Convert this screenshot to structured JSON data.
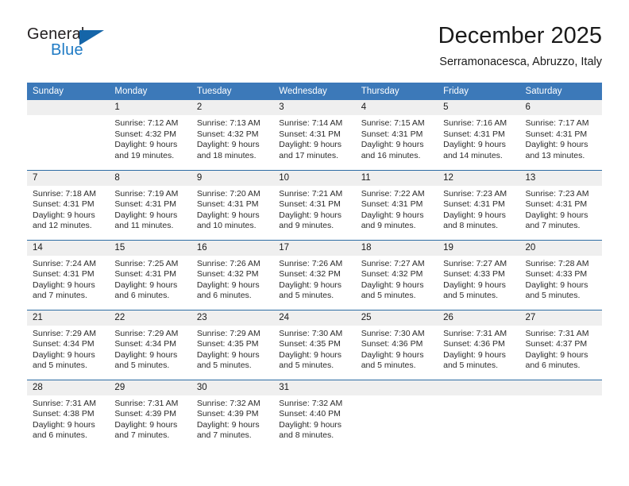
{
  "brand": {
    "name_top": "General",
    "name_bottom": "Blue",
    "triangle_icon": "blue-triangle-logo-mark",
    "color_top": "#231f20",
    "color_bottom": "#1e7ac4"
  },
  "header": {
    "title": "December 2025",
    "subtitle": "Serramonacesca, Abruzzo, Italy"
  },
  "theme": {
    "header_blue": "#3c79b9",
    "rule_blue": "#2e6da4",
    "daynum_gray": "#efefef"
  },
  "calendar": {
    "weekday_headers": [
      "Sunday",
      "Monday",
      "Tuesday",
      "Wednesday",
      "Thursday",
      "Friday",
      "Saturday"
    ],
    "weeks": [
      [
        {
          "day": "",
          "lines": []
        },
        {
          "day": "1",
          "lines": [
            "Sunrise: 7:12 AM",
            "Sunset: 4:32 PM",
            "Daylight: 9 hours",
            "and 19 minutes."
          ]
        },
        {
          "day": "2",
          "lines": [
            "Sunrise: 7:13 AM",
            "Sunset: 4:32 PM",
            "Daylight: 9 hours",
            "and 18 minutes."
          ]
        },
        {
          "day": "3",
          "lines": [
            "Sunrise: 7:14 AM",
            "Sunset: 4:31 PM",
            "Daylight: 9 hours",
            "and 17 minutes."
          ]
        },
        {
          "day": "4",
          "lines": [
            "Sunrise: 7:15 AM",
            "Sunset: 4:31 PM",
            "Daylight: 9 hours",
            "and 16 minutes."
          ]
        },
        {
          "day": "5",
          "lines": [
            "Sunrise: 7:16 AM",
            "Sunset: 4:31 PM",
            "Daylight: 9 hours",
            "and 14 minutes."
          ]
        },
        {
          "day": "6",
          "lines": [
            "Sunrise: 7:17 AM",
            "Sunset: 4:31 PM",
            "Daylight: 9 hours",
            "and 13 minutes."
          ]
        }
      ],
      [
        {
          "day": "7",
          "lines": [
            "Sunrise: 7:18 AM",
            "Sunset: 4:31 PM",
            "Daylight: 9 hours",
            "and 12 minutes."
          ]
        },
        {
          "day": "8",
          "lines": [
            "Sunrise: 7:19 AM",
            "Sunset: 4:31 PM",
            "Daylight: 9 hours",
            "and 11 minutes."
          ]
        },
        {
          "day": "9",
          "lines": [
            "Sunrise: 7:20 AM",
            "Sunset: 4:31 PM",
            "Daylight: 9 hours",
            "and 10 minutes."
          ]
        },
        {
          "day": "10",
          "lines": [
            "Sunrise: 7:21 AM",
            "Sunset: 4:31 PM",
            "Daylight: 9 hours",
            "and 9 minutes."
          ]
        },
        {
          "day": "11",
          "lines": [
            "Sunrise: 7:22 AM",
            "Sunset: 4:31 PM",
            "Daylight: 9 hours",
            "and 9 minutes."
          ]
        },
        {
          "day": "12",
          "lines": [
            "Sunrise: 7:23 AM",
            "Sunset: 4:31 PM",
            "Daylight: 9 hours",
            "and 8 minutes."
          ]
        },
        {
          "day": "13",
          "lines": [
            "Sunrise: 7:23 AM",
            "Sunset: 4:31 PM",
            "Daylight: 9 hours",
            "and 7 minutes."
          ]
        }
      ],
      [
        {
          "day": "14",
          "lines": [
            "Sunrise: 7:24 AM",
            "Sunset: 4:31 PM",
            "Daylight: 9 hours",
            "and 7 minutes."
          ]
        },
        {
          "day": "15",
          "lines": [
            "Sunrise: 7:25 AM",
            "Sunset: 4:31 PM",
            "Daylight: 9 hours",
            "and 6 minutes."
          ]
        },
        {
          "day": "16",
          "lines": [
            "Sunrise: 7:26 AM",
            "Sunset: 4:32 PM",
            "Daylight: 9 hours",
            "and 6 minutes."
          ]
        },
        {
          "day": "17",
          "lines": [
            "Sunrise: 7:26 AM",
            "Sunset: 4:32 PM",
            "Daylight: 9 hours",
            "and 5 minutes."
          ]
        },
        {
          "day": "18",
          "lines": [
            "Sunrise: 7:27 AM",
            "Sunset: 4:32 PM",
            "Daylight: 9 hours",
            "and 5 minutes."
          ]
        },
        {
          "day": "19",
          "lines": [
            "Sunrise: 7:27 AM",
            "Sunset: 4:33 PM",
            "Daylight: 9 hours",
            "and 5 minutes."
          ]
        },
        {
          "day": "20",
          "lines": [
            "Sunrise: 7:28 AM",
            "Sunset: 4:33 PM",
            "Daylight: 9 hours",
            "and 5 minutes."
          ]
        }
      ],
      [
        {
          "day": "21",
          "lines": [
            "Sunrise: 7:29 AM",
            "Sunset: 4:34 PM",
            "Daylight: 9 hours",
            "and 5 minutes."
          ]
        },
        {
          "day": "22",
          "lines": [
            "Sunrise: 7:29 AM",
            "Sunset: 4:34 PM",
            "Daylight: 9 hours",
            "and 5 minutes."
          ]
        },
        {
          "day": "23",
          "lines": [
            "Sunrise: 7:29 AM",
            "Sunset: 4:35 PM",
            "Daylight: 9 hours",
            "and 5 minutes."
          ]
        },
        {
          "day": "24",
          "lines": [
            "Sunrise: 7:30 AM",
            "Sunset: 4:35 PM",
            "Daylight: 9 hours",
            "and 5 minutes."
          ]
        },
        {
          "day": "25",
          "lines": [
            "Sunrise: 7:30 AM",
            "Sunset: 4:36 PM",
            "Daylight: 9 hours",
            "and 5 minutes."
          ]
        },
        {
          "day": "26",
          "lines": [
            "Sunrise: 7:31 AM",
            "Sunset: 4:36 PM",
            "Daylight: 9 hours",
            "and 5 minutes."
          ]
        },
        {
          "day": "27",
          "lines": [
            "Sunrise: 7:31 AM",
            "Sunset: 4:37 PM",
            "Daylight: 9 hours",
            "and 6 minutes."
          ]
        }
      ],
      [
        {
          "day": "28",
          "lines": [
            "Sunrise: 7:31 AM",
            "Sunset: 4:38 PM",
            "Daylight: 9 hours",
            "and 6 minutes."
          ]
        },
        {
          "day": "29",
          "lines": [
            "Sunrise: 7:31 AM",
            "Sunset: 4:39 PM",
            "Daylight: 9 hours",
            "and 7 minutes."
          ]
        },
        {
          "day": "30",
          "lines": [
            "Sunrise: 7:32 AM",
            "Sunset: 4:39 PM",
            "Daylight: 9 hours",
            "and 7 minutes."
          ]
        },
        {
          "day": "31",
          "lines": [
            "Sunrise: 7:32 AM",
            "Sunset: 4:40 PM",
            "Daylight: 9 hours",
            "and 8 minutes."
          ]
        },
        {
          "day": "",
          "lines": []
        },
        {
          "day": "",
          "lines": []
        },
        {
          "day": "",
          "lines": []
        }
      ]
    ]
  }
}
